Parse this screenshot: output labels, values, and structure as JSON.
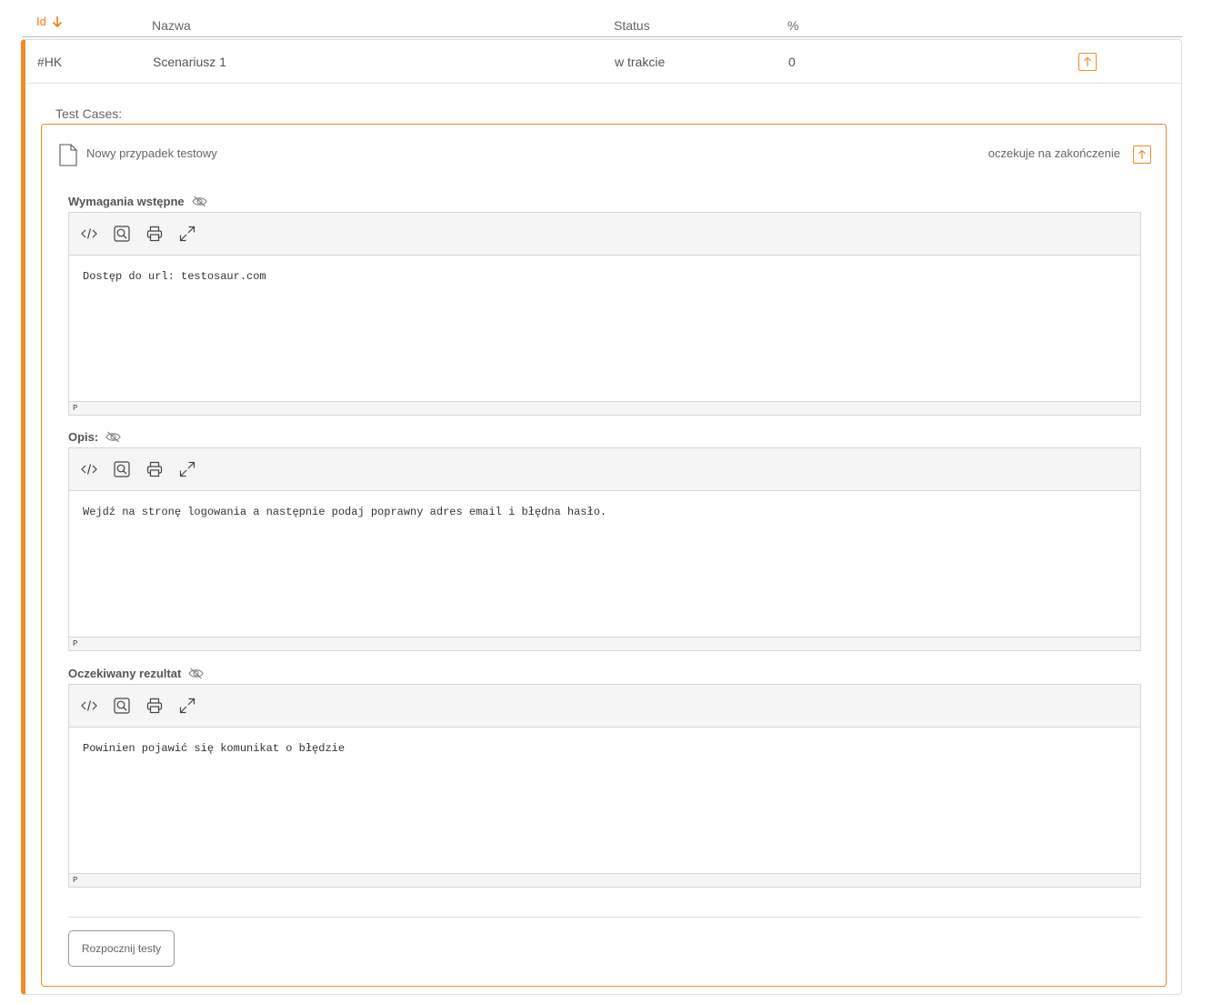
{
  "table": {
    "headers": {
      "id": "Id",
      "name": "Nazwa",
      "status": "Status",
      "percent": "%"
    },
    "sort_icon": "arrow-down-icon",
    "row": {
      "id": "#HK",
      "name": "Scenariusz 1",
      "status": "w trakcie",
      "percent": "0"
    }
  },
  "test_cases": {
    "label": "Test Cases:",
    "card": {
      "title": "Nowy przypadek testowy",
      "status": "oczekuje na zakończenie",
      "fields": [
        {
          "label": "Wymagania wstępne",
          "content": "Dostęp do url: testosaur.com",
          "status_tag": "P"
        },
        {
          "label": "Opis:",
          "content": "Wejdź na stronę logowania a następnie podaj poprawny adres email i błędna hasło.",
          "status_tag": "P"
        },
        {
          "label": "Oczekiwany rezultat",
          "content": "Powinien pojawić się komunikat o błędzie",
          "status_tag": "P"
        }
      ],
      "start_button": "Rozpocznij testy"
    }
  },
  "colors": {
    "accent": "#f28a26",
    "text": "#555555",
    "border": "#d6d6d6"
  }
}
